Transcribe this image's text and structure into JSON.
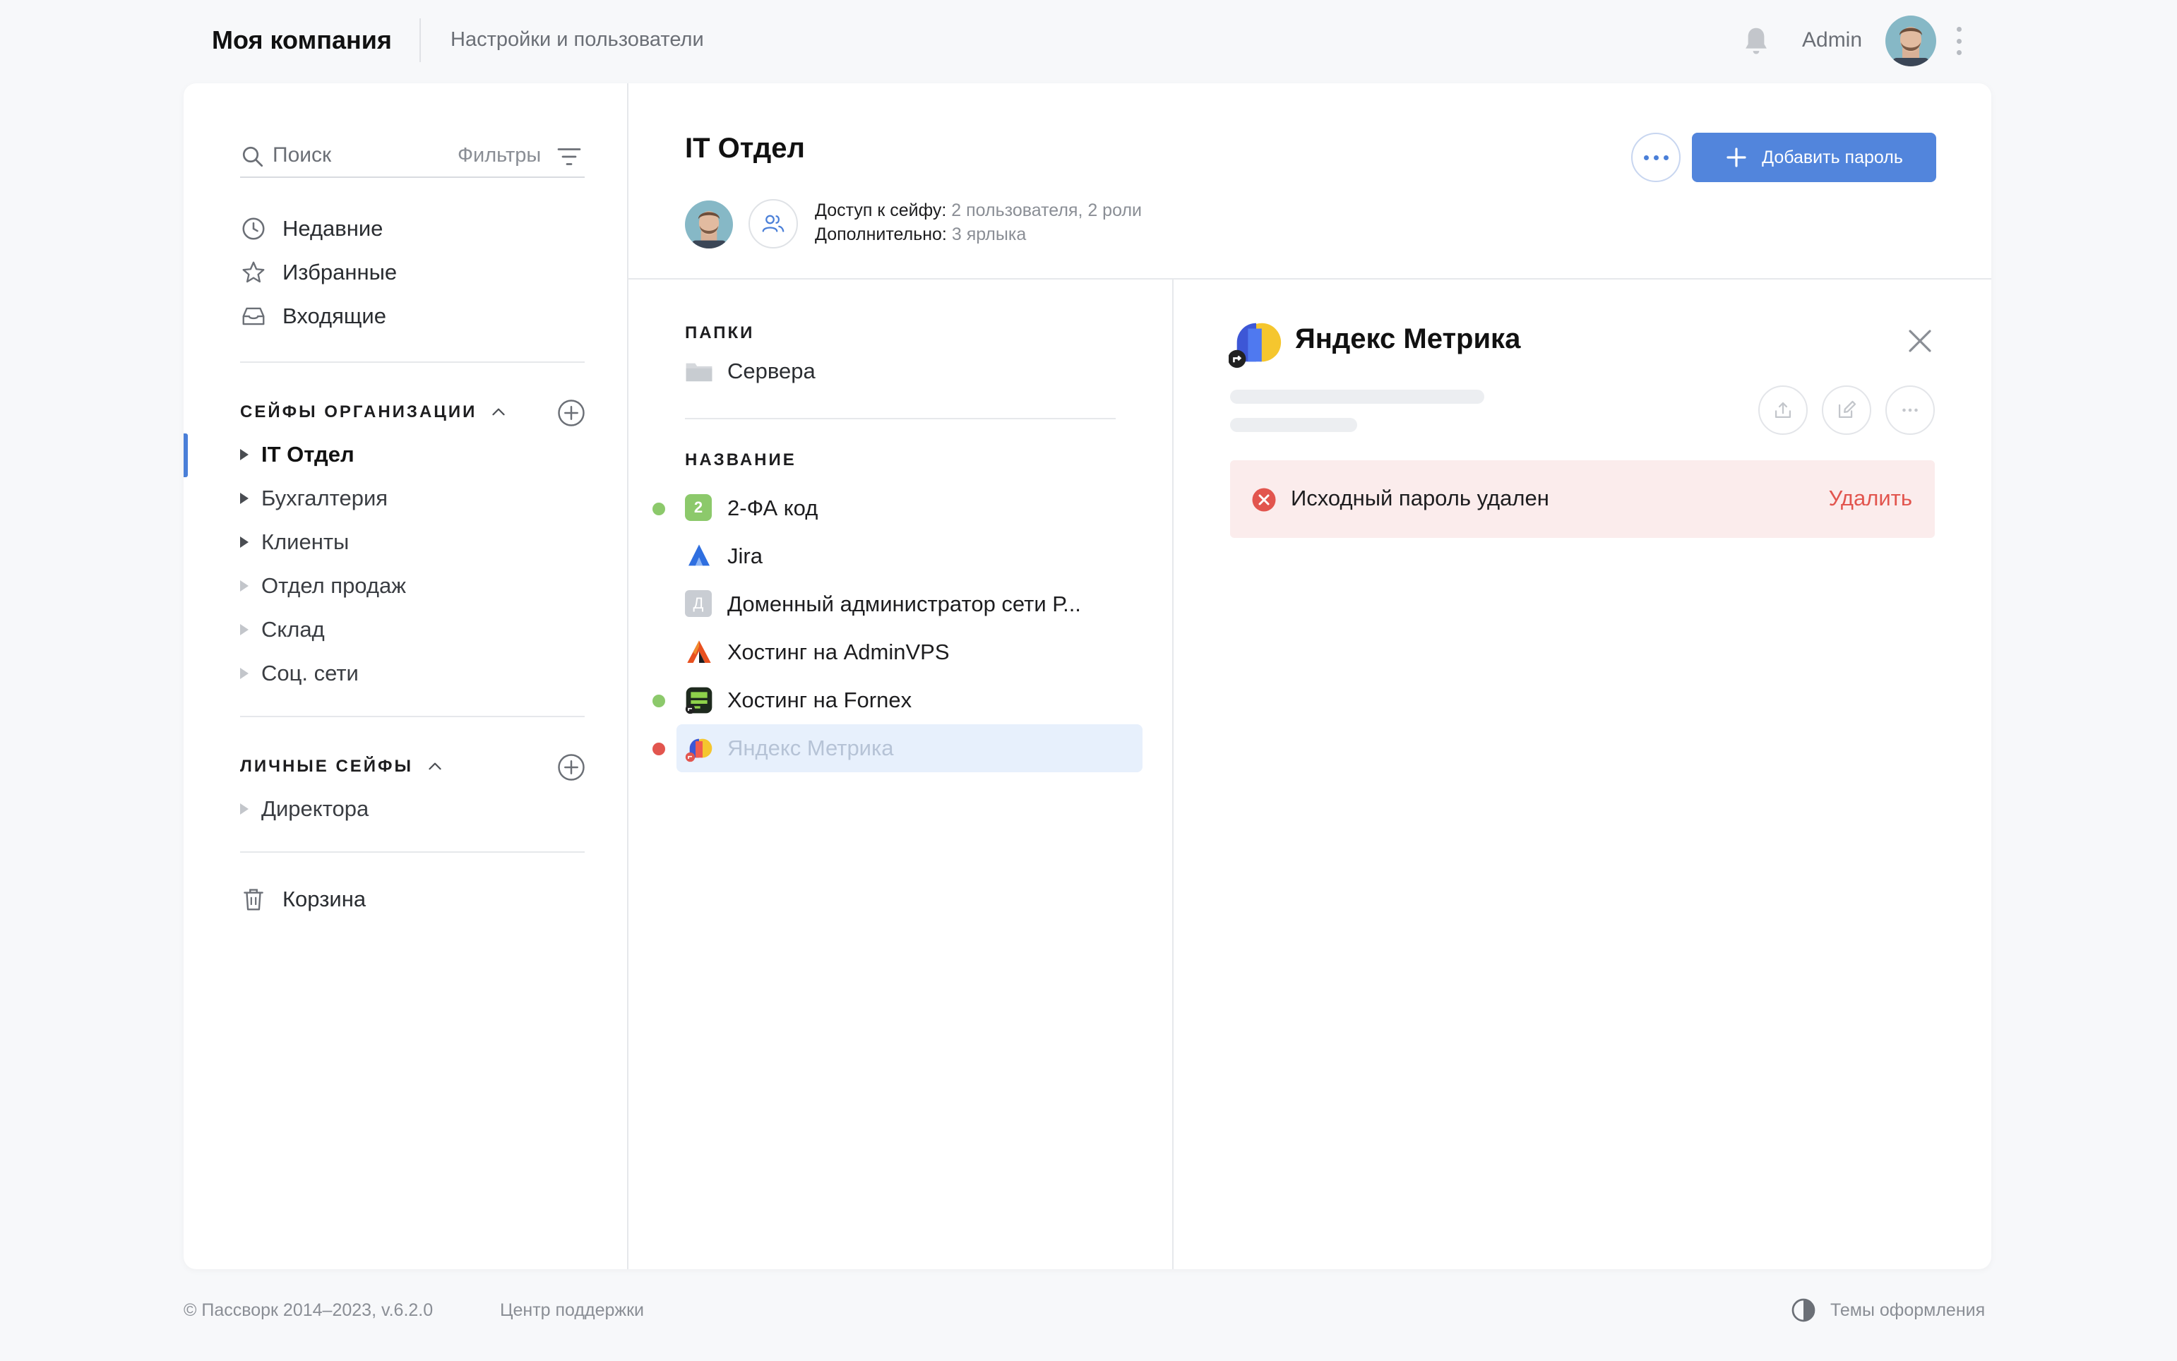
{
  "header": {
    "company": "Моя компания",
    "settings_link": "Настройки и пользователи",
    "user_name": "Admin"
  },
  "sidebar": {
    "search_placeholder": "Поиск",
    "filters_label": "Фильтры",
    "nav": [
      {
        "label": "Недавние",
        "icon": "clock-icon"
      },
      {
        "label": "Избранные",
        "icon": "star-icon"
      },
      {
        "label": "Входящие",
        "icon": "inbox-icon"
      }
    ],
    "org_section_title": "СЕЙФЫ ОРГАНИЗАЦИИ",
    "org_vaults": [
      {
        "label": "IT Отдел",
        "active": true
      },
      {
        "label": "Бухгалтерия"
      },
      {
        "label": "Клиенты"
      },
      {
        "label": "Отдел продаж"
      },
      {
        "label": "Склад"
      },
      {
        "label": "Соц. сети"
      }
    ],
    "personal_section_title": "ЛИЧНЫЕ СЕЙФЫ",
    "personal_vaults": [
      {
        "label": "Директора"
      }
    ],
    "trash_label": "Корзина"
  },
  "vault": {
    "title": "IT Отдел",
    "access_label": "Доступ к сейфу:",
    "access_value": "2 пользователя, 2 роли",
    "extra_label": "Дополнительно:",
    "extra_value": "3 ярлыка",
    "add_password_label": "Добавить пароль"
  },
  "list": {
    "folders_heading": "ПАПКИ",
    "folders": [
      {
        "label": "Сервера"
      }
    ],
    "names_heading": "НАЗВАНИЕ",
    "items": [
      {
        "label": "2-ФА код",
        "badge": "2",
        "status": "green"
      },
      {
        "label": "Jira",
        "icon": "jira-icon"
      },
      {
        "label": "Доменный администратор сети Р...",
        "badge": "Д"
      },
      {
        "label": "Хостинг на AdminVPS",
        "icon": "adminvps-icon"
      },
      {
        "label": "Хостинг на Fornex",
        "icon": "fornex-icon",
        "status": "green"
      },
      {
        "label": "Яндекс Метрика",
        "icon": "yandex-metrika-icon",
        "status": "red",
        "selected": true
      }
    ]
  },
  "detail": {
    "title": "Яндекс Метрика",
    "alert_text": "Исходный пароль удален",
    "alert_action": "Удалить"
  },
  "footer": {
    "copyright": "© Пассворк 2014–2023, v.6.2.0",
    "support": "Центр поддержки",
    "themes": "Темы оформления"
  },
  "colors": {
    "accent": "#5285dc",
    "status_green": "#8cc96b",
    "status_red": "#e2554e",
    "alert_bg": "#fbecec"
  }
}
